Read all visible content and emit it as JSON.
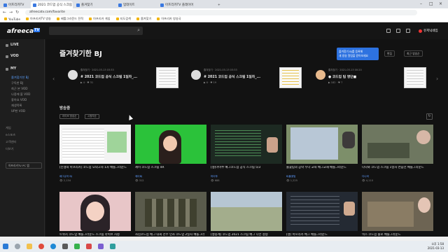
{
  "browser": {
    "tabs": [
      "아프리카TV",
      "2021 코드업 공식 스크림",
      "즐겨찾기",
      "업데이트",
      "아프리카TV 플레이어",
      "새 탭"
    ],
    "url": "afreecatv.com/favorite",
    "bookmarks": [
      "YouTube",
      "아프리카TV 방송",
      "배틀그라운드 전적",
      "아프리카 게임",
      "지도검색",
      "즐겨찾기",
      "아프리카 방송국"
    ]
  },
  "header": {
    "logo": "afreeca",
    "logo_badge": "TV",
    "user_badge": "유저닉네임"
  },
  "sidebar": {
    "live": "LIVE",
    "vod": "VOD",
    "my": "MY",
    "my_items": [
      "즐겨찾기한 BJ",
      "구독한 BJ",
      "최근 본 VOD",
      "나중에 볼 VOD",
      "좋아요 VOD",
      "재생목록",
      "UP한 VOD"
    ],
    "misc": [
      "게임",
      "e스포츠",
      "고객센터",
      "더보기"
    ],
    "pill": "아프리카TV PC 앱"
  },
  "page": {
    "title": "즐겨찾기한 BJ",
    "tooltip_line1": "즐겨찾기 BJ를 등록해",
    "tooltip_line2": "새 방송 알림을 받아보세요",
    "btn_edit": "편집",
    "btn_sort": "최근 방송순"
  },
  "favorites": [
    {
      "meta": "즐겨찾기 · 2021-03-13 03:33",
      "title": "# 2021 코드업 공식 스크림 1일차_...",
      "stats": "▶ 4 · ♥ 31",
      "avatar": "blank",
      "thumb": "grey"
    },
    {
      "meta": "즐겨찾기 · 2021-03-13 03:33",
      "title": "# 2021 코드업 공식 스크림 1일차_...",
      "stats": "▶ 6 · ♥ 19",
      "avatar": "blank",
      "thumb": "yellow"
    },
    {
      "meta": "즐겨찾기 · 2021-03-13 00:20",
      "title": "● 코드업 팀 명단■",
      "stats": "▶ 182 · ♥ 7",
      "avatar": "face",
      "thumb": "grey"
    }
  ],
  "section_title": "방송중",
  "filters": [
    "라이브 방송순",
    "시청자순"
  ],
  "videos": [
    {
      "title": "[인생의 아프리카] 코드업 모의고사 1차 배틀그라운드",
      "user": "배그유저 BJ",
      "views": "👁 2,134",
      "thumb": "t-sheet"
    },
    {
      "title": "제이 코드업 스크림 4R",
      "user": "제이BJ",
      "views": "👁 312",
      "thumb": "t-green"
    },
    {
      "title": "[생]마이쭈 배그코드업 공식 스크림 5/3",
      "user": "마이쭈",
      "views": "👁 688",
      "thumb": "t-code"
    },
    {
      "title": "불꽃팀의 공략 누나 교육 배그교재 배틀그라운드",
      "user": "BJ불꽃팀",
      "views": "👁 1,225",
      "thumb": "t-map"
    },
    {
      "title": "다나와 코드업 스크림 1일차 연습전 배틀그라운드",
      "user": "다나와",
      "views": "👁 4,110",
      "thumb": "t-game"
    },
    {
      "title": "트위치 코드업 배틀그라운드 스크림 라이브 시청",
      "user": "트위치BJ",
      "views": "👁 1,567",
      "thumb": "t-pink"
    },
    {
      "title": "사김코드업 배그 대회 선수 인사 코드업 2일차 배틀그라운드",
      "user": "사김",
      "views": "👁 918",
      "thumb": "t-soldier"
    },
    {
      "title": "[생중계] 코드업 2021 스크림 배그 다전 결승",
      "user": "코드업중계",
      "views": "👁 2,302",
      "thumb": "t-field"
    },
    {
      "title": "[생] 아프리카 배그 배틀그라운드",
      "user": "BJ배그",
      "views": "👁 743",
      "thumb": "t-dark"
    },
    {
      "title": "넥스 코드업 솔로 배틀그라운드",
      "user": "넥스",
      "views": "👁 1,036",
      "thumb": "t-ruin"
    }
  ],
  "taskbar": {
    "time": "오후 1:58",
    "date": "2021-03-13"
  }
}
